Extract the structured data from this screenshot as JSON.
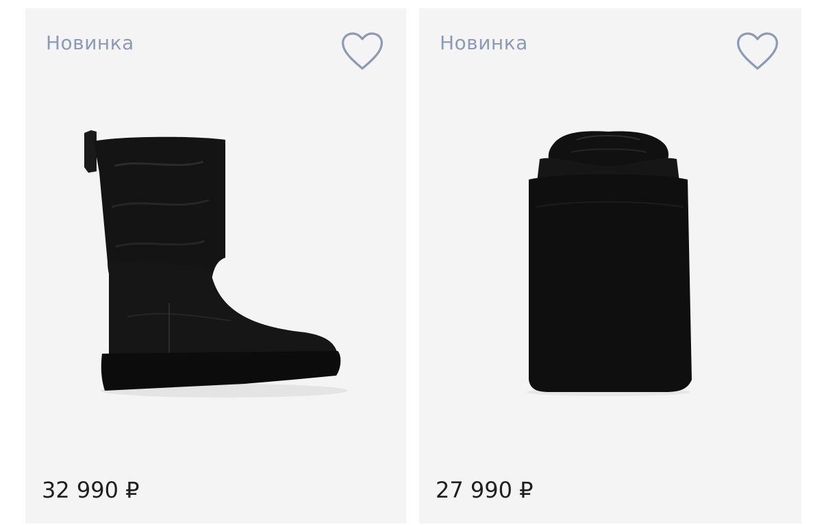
{
  "products": [
    {
      "badge": "Новинка",
      "price": "32 990 ₽",
      "favorite_icon": "heart-outline-icon",
      "image": "black-leather-boot"
    },
    {
      "badge": "Новинка",
      "price": "27 990 ₽",
      "favorite_icon": "heart-outline-icon",
      "image": "black-leather-drawstring-bag"
    }
  ],
  "colors": {
    "card_bg": "#f4f4f4",
    "badge": "#8b9bb5",
    "heart_stroke": "#8b9bb5",
    "price": "#1f1f1f"
  }
}
